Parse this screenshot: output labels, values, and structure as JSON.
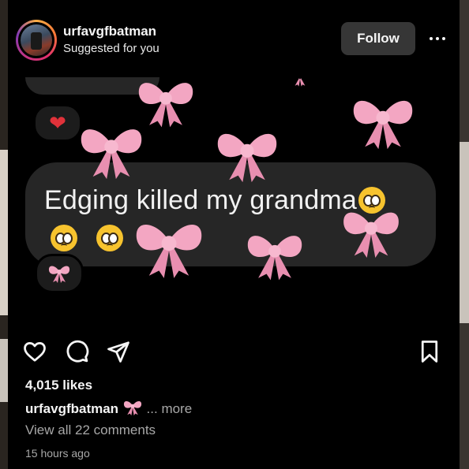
{
  "header": {
    "username": "urfavgfbatman",
    "subtitle": "Suggested for you",
    "follow_label": "Follow"
  },
  "media": {
    "top_reaction": "❤",
    "message_text": "Edging killed my grandma",
    "bottom_reaction": "🎀",
    "icons": [
      "heart-reaction-icon",
      "pleading-face-emoji-icon",
      "pink-bow-sticker-icon"
    ],
    "colors": {
      "bubble": "#262626",
      "bow": "#f3a6c2",
      "heart": "#e0323a"
    }
  },
  "actions": {
    "icons": [
      "heart-icon",
      "comment-icon",
      "share-icon",
      "bookmark-icon"
    ]
  },
  "likes": "4,015 likes",
  "caption": {
    "username": "urfavgfbatman",
    "emoji": "🎀",
    "more": "... more"
  },
  "comments_link": "View all 22 comments",
  "timestamp": "15 hours ago"
}
